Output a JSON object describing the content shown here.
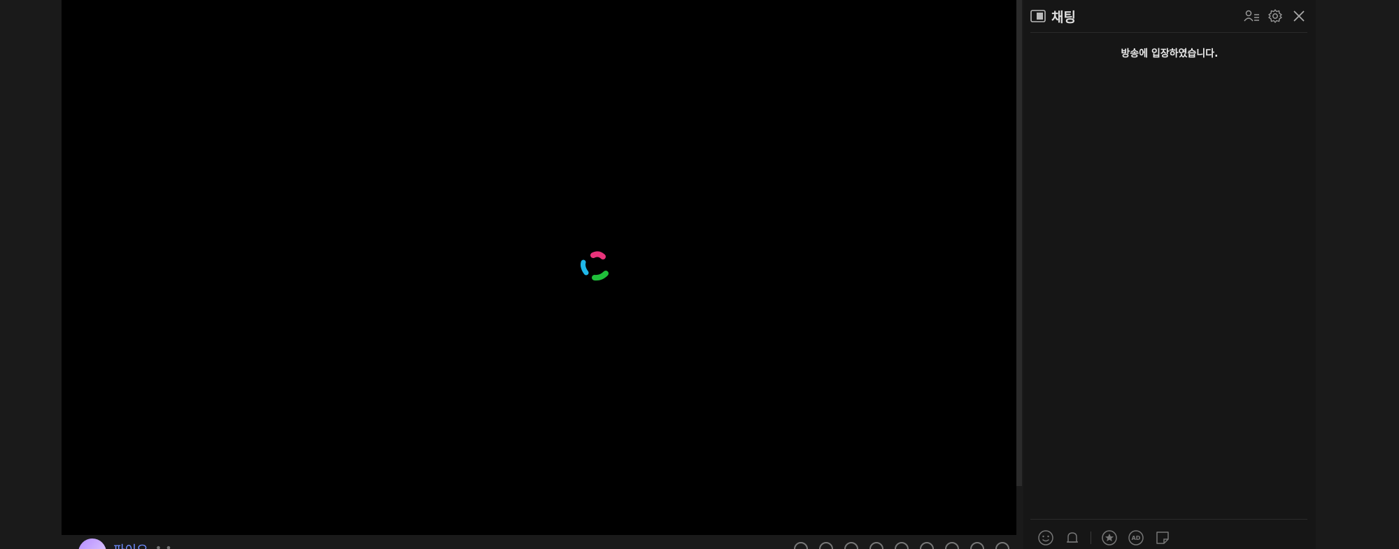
{
  "player": {
    "streamer_name": "파이오",
    "streamer_extra": "• •"
  },
  "chat": {
    "title": "채팅",
    "system_message": "방송에 입장하였습니다."
  },
  "icons": {
    "panel_toggle": "panel-toggle-icon",
    "user_list": "user-list-icon",
    "settings": "gear-icon",
    "close": "close-icon",
    "emoji": "emoji-icon",
    "bell": "bell-icon",
    "star": "star-icon",
    "ad": "ad-icon",
    "sticker": "sticker-icon"
  },
  "colors": {
    "spinner_pink": "#e8337a",
    "spinner_blue": "#1fb7e8",
    "spinner_green": "#1fbf3a",
    "name_blue": "#6f8cff"
  }
}
